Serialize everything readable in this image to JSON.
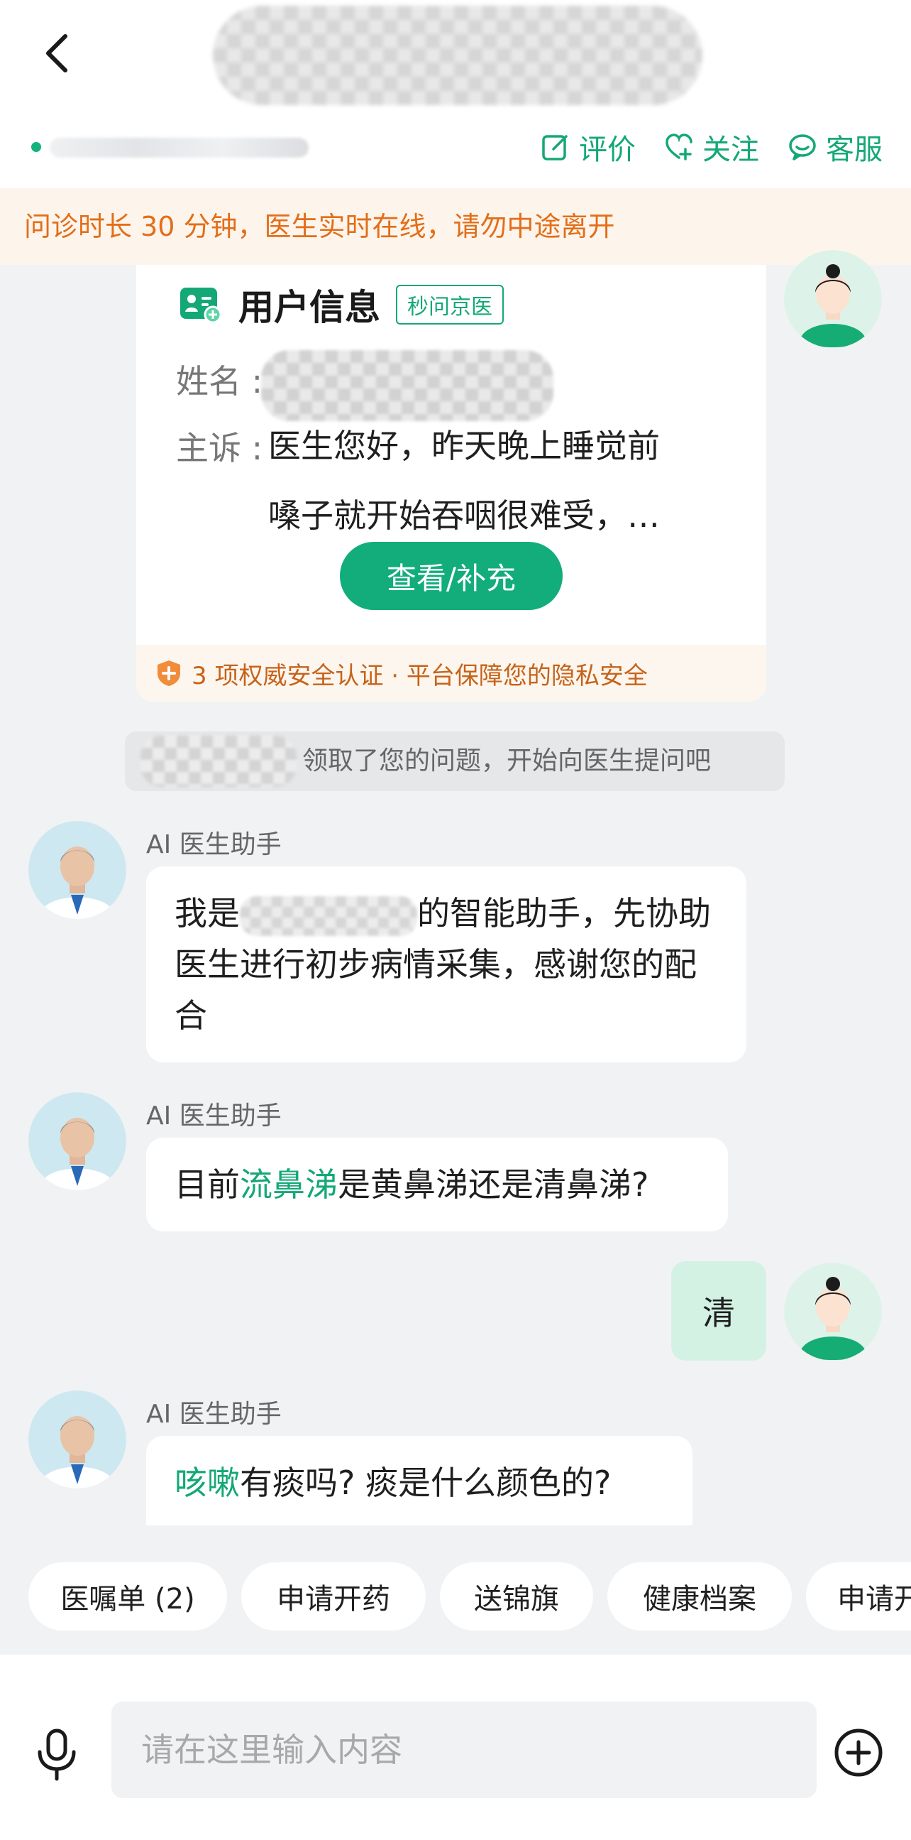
{
  "header": {
    "actions": [
      {
        "label": "评价",
        "icon": "edit-icon"
      },
      {
        "label": "关注",
        "icon": "heart-plus-icon"
      },
      {
        "label": "客服",
        "icon": "chat-service-icon"
      }
    ]
  },
  "notice": {
    "text": "问诊时长 30 分钟，医生实时在线，请勿中途离开"
  },
  "user_card": {
    "title": "用户信息",
    "tag": "秒问京医",
    "name_label": "姓名 :",
    "complaint_label": "主诉 :",
    "complaint_line1": "医生您好，昨天晚上睡觉前",
    "complaint_line2": "嗓子就开始吞咽很难受，…",
    "view_button": "查看/补充",
    "safety_text": "3 项权威安全认证 · 平台保障您的隐私安全"
  },
  "system_message": {
    "text": "领取了您的问题，开始向医生提问吧"
  },
  "messages": {
    "m1": {
      "sender": "AI 医生助手",
      "prefix": "我是",
      "suffix": "的智能助手，先协助医生进行初步病情采集，感谢您的配合"
    },
    "m2": {
      "sender": "AI 医生助手",
      "before": "目前",
      "highlight": "流鼻涕",
      "after": "是黄鼻涕还是清鼻涕?"
    },
    "user_reply": {
      "text": "清"
    },
    "m3": {
      "sender": "AI 医生助手",
      "highlight": "咳嗽",
      "after": "有痰吗? 痰是什么颜色的?"
    }
  },
  "quick_actions": [
    "医嘱单 (2)",
    "申请开药",
    "送锦旗",
    "健康档案",
    "申请开"
  ],
  "input": {
    "placeholder": "请在这里输入内容"
  },
  "colors": {
    "accent": "#14a877",
    "notice_text": "#e36e19",
    "notice_bg": "#fdf5ec",
    "user_bubble": "#d3f2e4",
    "background": "#f1f2f4"
  }
}
